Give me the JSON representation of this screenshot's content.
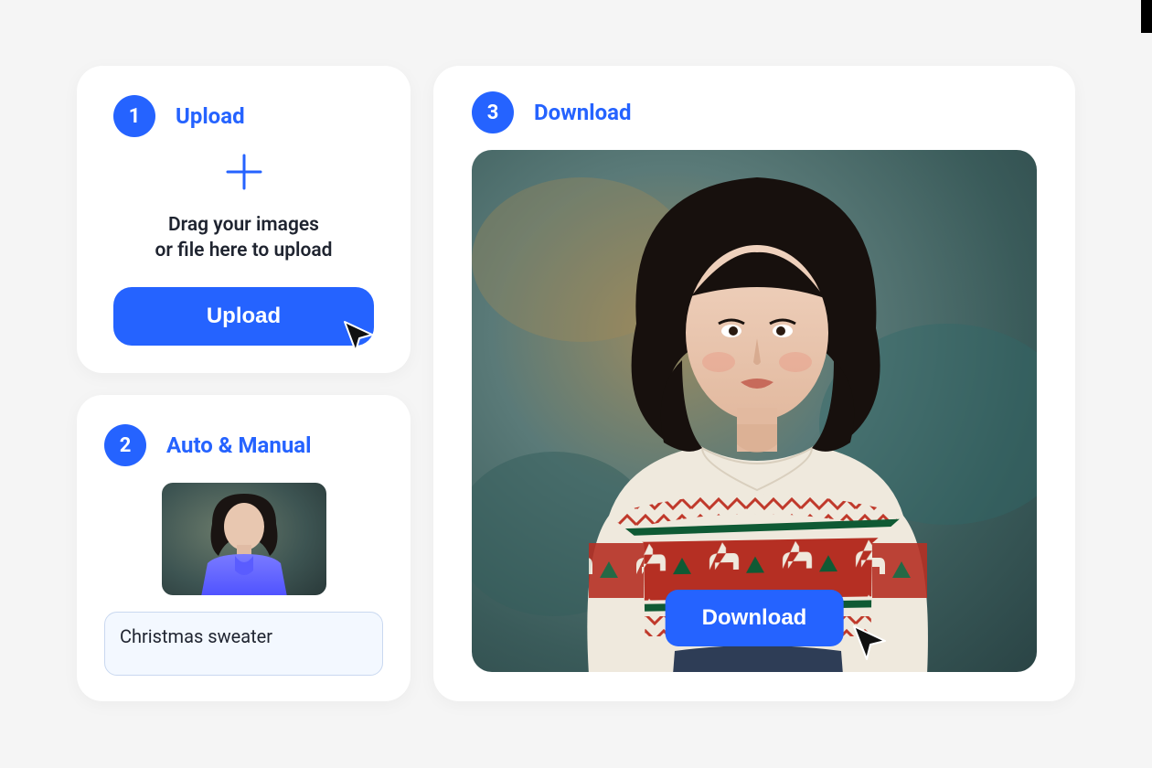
{
  "steps": {
    "upload": {
      "number": "1",
      "title": "Upload",
      "drop_line1": "Drag your images",
      "drop_line2": "or file here to upload",
      "button_label": "Upload"
    },
    "prompt": {
      "number": "2",
      "title": "Auto &  Manual",
      "input_value": "Christmas sweater"
    },
    "download": {
      "number": "3",
      "title": "Download",
      "button_label": "Download"
    }
  },
  "colors": {
    "accent": "#2563ff",
    "card_bg": "#ffffff",
    "page_bg": "#f5f5f5"
  }
}
